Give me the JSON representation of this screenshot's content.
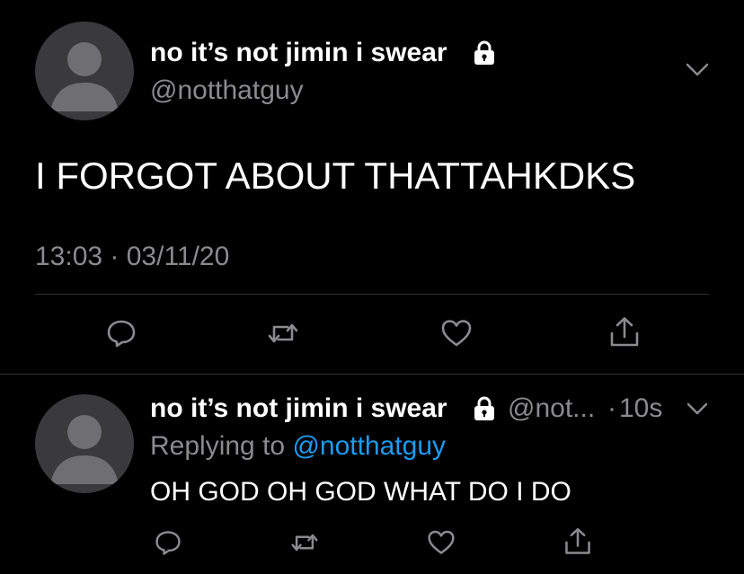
{
  "main_tweet": {
    "display_name": "no it’s not jimin i swear",
    "handle": "@notthatguy",
    "text": "I FORGOT ABOUT THATTAHKDKS",
    "timestamp": "13:03 · 03/11/20"
  },
  "reply": {
    "display_name": "no it’s not jimin i swear",
    "handle": "@not...",
    "separator": "·",
    "time_ago": "10s",
    "replying_prefix": "Replying to",
    "replying_handle": "@notthatguy",
    "text": "OH GOD OH GOD WHAT DO I DO"
  },
  "icons": {
    "lock": "lock-icon",
    "chevron": "chevron-down-icon",
    "reply": "reply-icon",
    "retweet": "retweet-icon",
    "like": "heart-icon",
    "share": "share-icon"
  },
  "colors": {
    "background": "#000000",
    "text": "#ffffff",
    "muted": "#8b8b8f",
    "link": "#1d9bf0",
    "avatar": "#3a3a3c",
    "avatar_figure": "#6e6e73",
    "divider": "#2f2f33"
  }
}
